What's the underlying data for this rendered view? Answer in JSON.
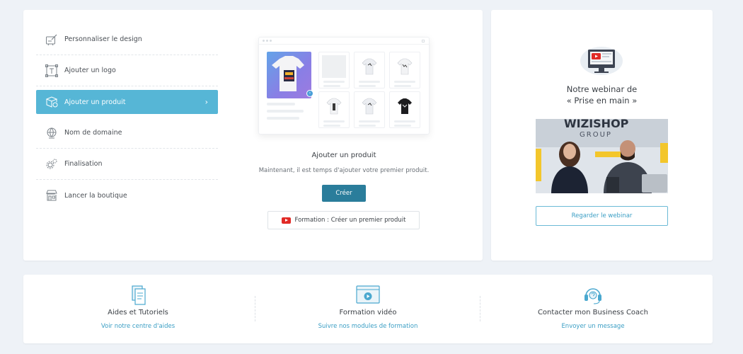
{
  "steps": [
    {
      "label": "Personnaliser le design",
      "icon": "design-icon"
    },
    {
      "label": "Ajouter un logo",
      "icon": "logo-icon"
    },
    {
      "label": "Ajouter un produit",
      "icon": "product-box-icon",
      "active": true
    },
    {
      "label": "Nom de domaine",
      "icon": "domain-globe-icon"
    },
    {
      "label": "Finalisation",
      "icon": "settings-gears-icon"
    },
    {
      "label": "Lancer la boutique",
      "icon": "shop-icon"
    }
  ],
  "current_step": {
    "title": "Ajouter un produit",
    "description": "Maintenant, il est temps d'ajouter votre premier produit.",
    "create_label": "Créer",
    "training_label": "Formation : Créer un premier produit"
  },
  "webinar": {
    "title_line1": "Notre webinar de",
    "title_line2": "« Prise en main »",
    "photo_text_brand": "WIZISHOP",
    "photo_text_group": "GROUP",
    "button_label": "Regarder le webinar"
  },
  "help": [
    {
      "title": "Aides et Tutoriels",
      "link": "Voir notre centre d'aides",
      "icon": "help-docs-icon"
    },
    {
      "title": "Formation vidéo",
      "link": "Suivre nos modules de formation",
      "icon": "video-play-icon"
    },
    {
      "title": "Contacter mon Business Coach",
      "link": "Envoyer un message",
      "icon": "headset-icon"
    }
  ],
  "colors": {
    "accent": "#56b6d6",
    "primary_button": "#2a7d9b",
    "link": "#3a9ec4",
    "background": "#eef2f7"
  }
}
